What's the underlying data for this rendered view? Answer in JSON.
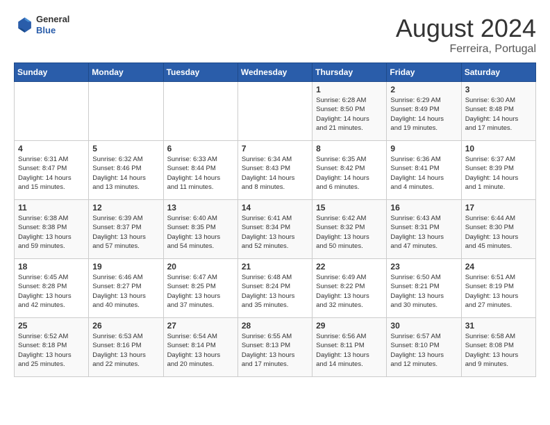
{
  "header": {
    "logo_general": "General",
    "logo_blue": "Blue",
    "title": "August 2024",
    "subtitle": "Ferreira, Portugal"
  },
  "days_of_week": [
    "Sunday",
    "Monday",
    "Tuesday",
    "Wednesday",
    "Thursday",
    "Friday",
    "Saturday"
  ],
  "weeks": [
    [
      {
        "day": "",
        "info": ""
      },
      {
        "day": "",
        "info": ""
      },
      {
        "day": "",
        "info": ""
      },
      {
        "day": "",
        "info": ""
      },
      {
        "day": "1",
        "info": "Sunrise: 6:28 AM\nSunset: 8:50 PM\nDaylight: 14 hours\nand 21 minutes."
      },
      {
        "day": "2",
        "info": "Sunrise: 6:29 AM\nSunset: 8:49 PM\nDaylight: 14 hours\nand 19 minutes."
      },
      {
        "day": "3",
        "info": "Sunrise: 6:30 AM\nSunset: 8:48 PM\nDaylight: 14 hours\nand 17 minutes."
      }
    ],
    [
      {
        "day": "4",
        "info": "Sunrise: 6:31 AM\nSunset: 8:47 PM\nDaylight: 14 hours\nand 15 minutes."
      },
      {
        "day": "5",
        "info": "Sunrise: 6:32 AM\nSunset: 8:46 PM\nDaylight: 14 hours\nand 13 minutes."
      },
      {
        "day": "6",
        "info": "Sunrise: 6:33 AM\nSunset: 8:44 PM\nDaylight: 14 hours\nand 11 minutes."
      },
      {
        "day": "7",
        "info": "Sunrise: 6:34 AM\nSunset: 8:43 PM\nDaylight: 14 hours\nand 8 minutes."
      },
      {
        "day": "8",
        "info": "Sunrise: 6:35 AM\nSunset: 8:42 PM\nDaylight: 14 hours\nand 6 minutes."
      },
      {
        "day": "9",
        "info": "Sunrise: 6:36 AM\nSunset: 8:41 PM\nDaylight: 14 hours\nand 4 minutes."
      },
      {
        "day": "10",
        "info": "Sunrise: 6:37 AM\nSunset: 8:39 PM\nDaylight: 14 hours\nand 1 minute."
      }
    ],
    [
      {
        "day": "11",
        "info": "Sunrise: 6:38 AM\nSunset: 8:38 PM\nDaylight: 13 hours\nand 59 minutes."
      },
      {
        "day": "12",
        "info": "Sunrise: 6:39 AM\nSunset: 8:37 PM\nDaylight: 13 hours\nand 57 minutes."
      },
      {
        "day": "13",
        "info": "Sunrise: 6:40 AM\nSunset: 8:35 PM\nDaylight: 13 hours\nand 54 minutes."
      },
      {
        "day": "14",
        "info": "Sunrise: 6:41 AM\nSunset: 8:34 PM\nDaylight: 13 hours\nand 52 minutes."
      },
      {
        "day": "15",
        "info": "Sunrise: 6:42 AM\nSunset: 8:32 PM\nDaylight: 13 hours\nand 50 minutes."
      },
      {
        "day": "16",
        "info": "Sunrise: 6:43 AM\nSunset: 8:31 PM\nDaylight: 13 hours\nand 47 minutes."
      },
      {
        "day": "17",
        "info": "Sunrise: 6:44 AM\nSunset: 8:30 PM\nDaylight: 13 hours\nand 45 minutes."
      }
    ],
    [
      {
        "day": "18",
        "info": "Sunrise: 6:45 AM\nSunset: 8:28 PM\nDaylight: 13 hours\nand 42 minutes."
      },
      {
        "day": "19",
        "info": "Sunrise: 6:46 AM\nSunset: 8:27 PM\nDaylight: 13 hours\nand 40 minutes."
      },
      {
        "day": "20",
        "info": "Sunrise: 6:47 AM\nSunset: 8:25 PM\nDaylight: 13 hours\nand 37 minutes."
      },
      {
        "day": "21",
        "info": "Sunrise: 6:48 AM\nSunset: 8:24 PM\nDaylight: 13 hours\nand 35 minutes."
      },
      {
        "day": "22",
        "info": "Sunrise: 6:49 AM\nSunset: 8:22 PM\nDaylight: 13 hours\nand 32 minutes."
      },
      {
        "day": "23",
        "info": "Sunrise: 6:50 AM\nSunset: 8:21 PM\nDaylight: 13 hours\nand 30 minutes."
      },
      {
        "day": "24",
        "info": "Sunrise: 6:51 AM\nSunset: 8:19 PM\nDaylight: 13 hours\nand 27 minutes."
      }
    ],
    [
      {
        "day": "25",
        "info": "Sunrise: 6:52 AM\nSunset: 8:18 PM\nDaylight: 13 hours\nand 25 minutes."
      },
      {
        "day": "26",
        "info": "Sunrise: 6:53 AM\nSunset: 8:16 PM\nDaylight: 13 hours\nand 22 minutes."
      },
      {
        "day": "27",
        "info": "Sunrise: 6:54 AM\nSunset: 8:14 PM\nDaylight: 13 hours\nand 20 minutes."
      },
      {
        "day": "28",
        "info": "Sunrise: 6:55 AM\nSunset: 8:13 PM\nDaylight: 13 hours\nand 17 minutes."
      },
      {
        "day": "29",
        "info": "Sunrise: 6:56 AM\nSunset: 8:11 PM\nDaylight: 13 hours\nand 14 minutes."
      },
      {
        "day": "30",
        "info": "Sunrise: 6:57 AM\nSunset: 8:10 PM\nDaylight: 13 hours\nand 12 minutes."
      },
      {
        "day": "31",
        "info": "Sunrise: 6:58 AM\nSunset: 8:08 PM\nDaylight: 13 hours\nand 9 minutes."
      }
    ]
  ]
}
